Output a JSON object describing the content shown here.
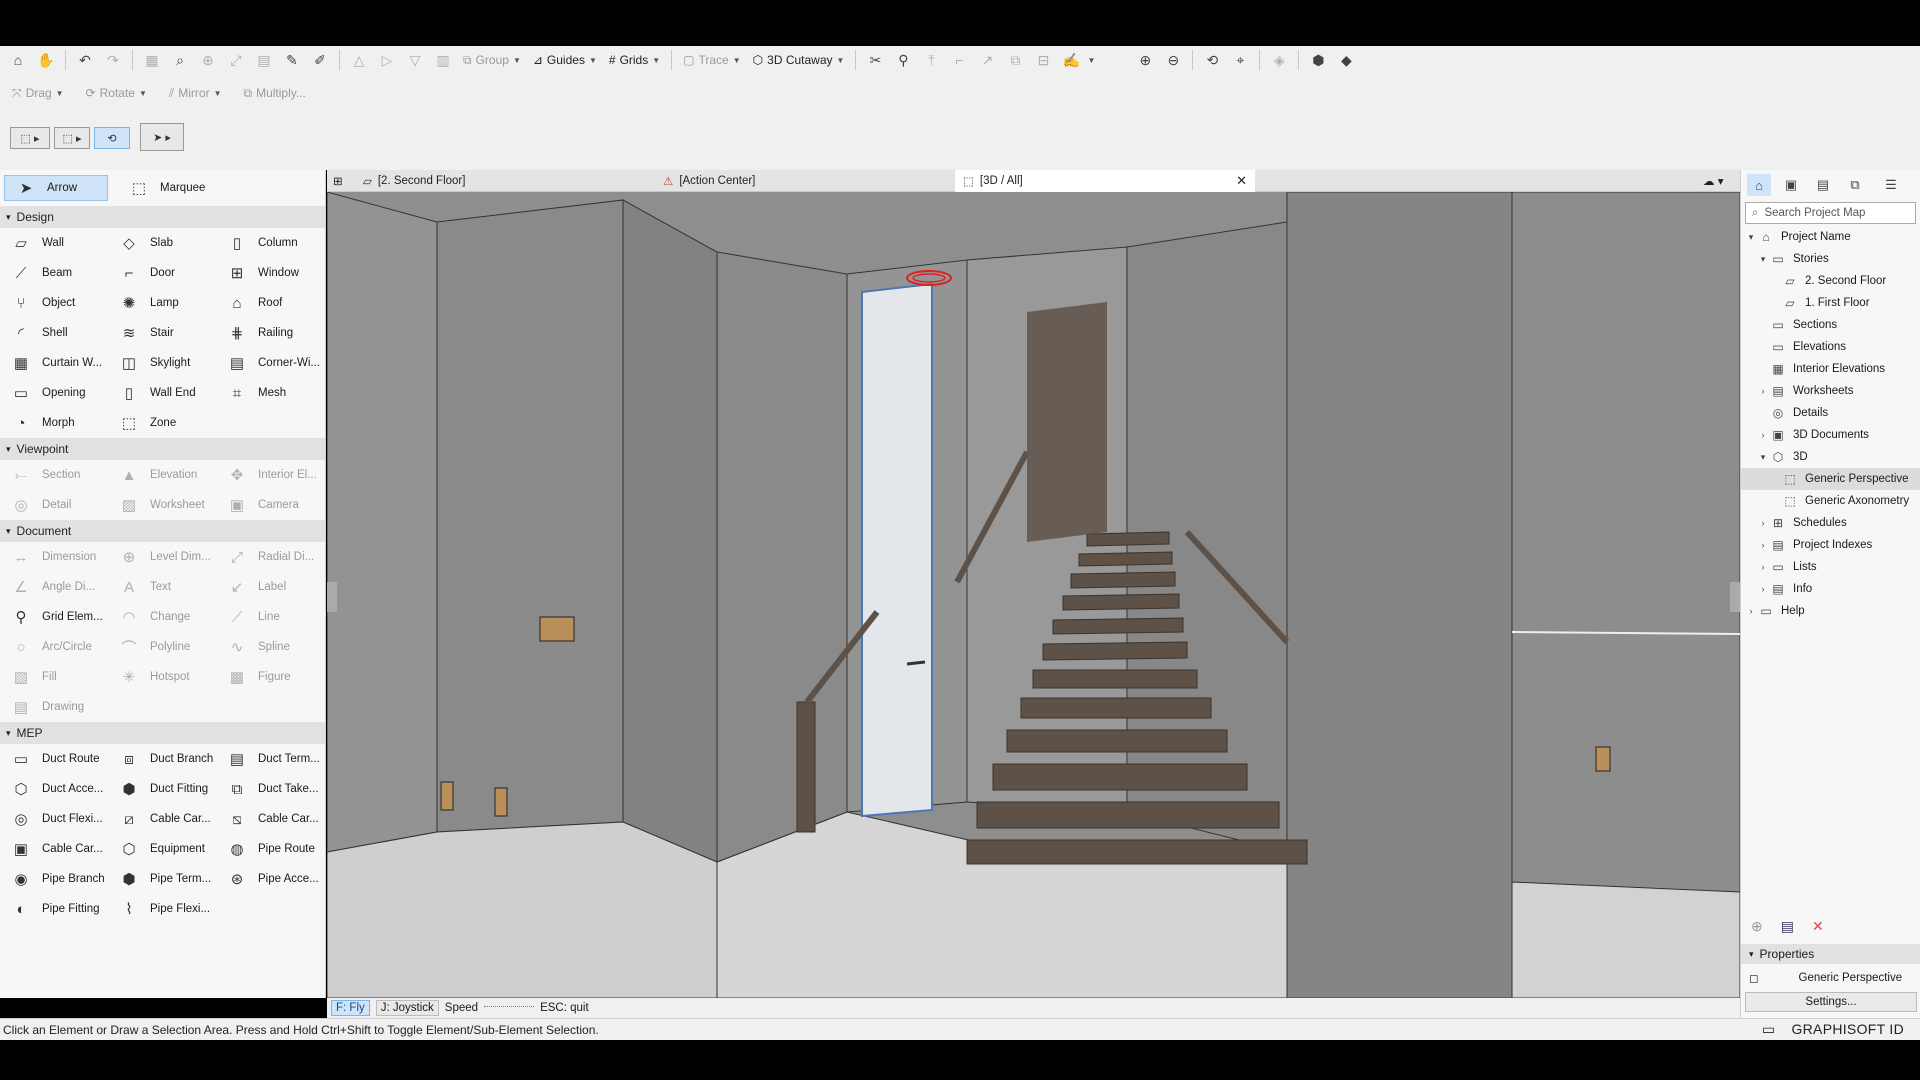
{
  "toolbar1": {
    "group_label": "Group",
    "guides_label": "Guides",
    "grids_label": "Grids",
    "trace_label": "Trace",
    "cutaway_label": "3D Cutaway"
  },
  "toolbar2": {
    "drag_label": "Drag",
    "rotate_label": "Rotate",
    "mirror_label": "Mirror",
    "multiply_label": "Multiply..."
  },
  "toolbox": {
    "arrow": "Arrow",
    "marquee": "Marquee",
    "sections": [
      {
        "title": "Design",
        "tools": [
          {
            "label": "Wall",
            "icon": "▱",
            "dim": false
          },
          {
            "label": "Slab",
            "icon": "◇",
            "dim": false
          },
          {
            "label": "Column",
            "icon": "▯",
            "dim": false
          },
          {
            "label": "Beam",
            "icon": "⟋",
            "dim": false
          },
          {
            "label": "Door",
            "icon": "⌐",
            "dim": false
          },
          {
            "label": "Window",
            "icon": "⊞",
            "dim": false
          },
          {
            "label": "Object",
            "icon": "⑂",
            "dim": false
          },
          {
            "label": "Lamp",
            "icon": "✺",
            "dim": false
          },
          {
            "label": "Roof",
            "icon": "⌂",
            "dim": false
          },
          {
            "label": "Shell",
            "icon": "◜",
            "dim": false
          },
          {
            "label": "Stair",
            "icon": "≋",
            "dim": false
          },
          {
            "label": "Railing",
            "icon": "⋕",
            "dim": false
          },
          {
            "label": "Curtain W...",
            "icon": "▦",
            "dim": false
          },
          {
            "label": "Skylight",
            "icon": "◫",
            "dim": false
          },
          {
            "label": "Corner-Wi...",
            "icon": "▤",
            "dim": false
          },
          {
            "label": "Opening",
            "icon": "▭",
            "dim": false
          },
          {
            "label": "Wall End",
            "icon": "▯",
            "dim": false
          },
          {
            "label": "Mesh",
            "icon": "⌗",
            "dim": false
          },
          {
            "label": "Morph",
            "icon": "◔",
            "dim": false
          },
          {
            "label": "Zone",
            "icon": "⬚",
            "dim": false
          }
        ]
      },
      {
        "title": "Viewpoint",
        "tools": [
          {
            "label": "Section",
            "icon": "⤚",
            "dim": true
          },
          {
            "label": "Elevation",
            "icon": "▲",
            "dim": true
          },
          {
            "label": "Interior El...",
            "icon": "✥",
            "dim": true
          },
          {
            "label": "Detail",
            "icon": "◎",
            "dim": true
          },
          {
            "label": "Worksheet",
            "icon": "▨",
            "dim": true
          },
          {
            "label": "Camera",
            "icon": "▣",
            "dim": true
          }
        ]
      },
      {
        "title": "Document",
        "tools": [
          {
            "label": "Dimension",
            "icon": "↔",
            "dim": true
          },
          {
            "label": "Level Dim...",
            "icon": "⊕",
            "dim": true
          },
          {
            "label": "Radial Di...",
            "icon": "⤢",
            "dim": true
          },
          {
            "label": "Angle Di...",
            "icon": "∠",
            "dim": true
          },
          {
            "label": "Text",
            "icon": "A",
            "dim": true
          },
          {
            "label": "Label",
            "icon": "↙",
            "dim": true
          },
          {
            "label": "Grid Elem...",
            "icon": "⚲",
            "dim": false
          },
          {
            "label": "Change",
            "icon": "◠",
            "dim": true
          },
          {
            "label": "Line",
            "icon": "⟋",
            "dim": true
          },
          {
            "label": "Arc/Circle",
            "icon": "○",
            "dim": true
          },
          {
            "label": "Polyline",
            "icon": "⌒",
            "dim": true
          },
          {
            "label": "Spline",
            "icon": "∿",
            "dim": true
          },
          {
            "label": "Fill",
            "icon": "▧",
            "dim": true
          },
          {
            "label": "Hotspot",
            "icon": "✳",
            "dim": true
          },
          {
            "label": "Figure",
            "icon": "▩",
            "dim": true
          },
          {
            "label": "Drawing",
            "icon": "▤",
            "dim": true
          }
        ]
      },
      {
        "title": "MEP",
        "tools": [
          {
            "label": "Duct Route",
            "icon": "▭",
            "dim": false
          },
          {
            "label": "Duct Branch",
            "icon": "⧈",
            "dim": false
          },
          {
            "label": "Duct Term...",
            "icon": "▤",
            "dim": false
          },
          {
            "label": "Duct Acce...",
            "icon": "⬡",
            "dim": false
          },
          {
            "label": "Duct Fitting",
            "icon": "⬢",
            "dim": false
          },
          {
            "label": "Duct Take...",
            "icon": "⧉",
            "dim": false
          },
          {
            "label": "Duct Flexi...",
            "icon": "◎",
            "dim": false
          },
          {
            "label": "Cable Car...",
            "icon": "⧄",
            "dim": false
          },
          {
            "label": "Cable Car...",
            "icon": "⧅",
            "dim": false
          },
          {
            "label": "Cable Car...",
            "icon": "▣",
            "dim": false
          },
          {
            "label": "Equipment",
            "icon": "⬡",
            "dim": false
          },
          {
            "label": "Pipe Route",
            "icon": "◍",
            "dim": false
          },
          {
            "label": "Pipe Branch",
            "icon": "◉",
            "dim": false
          },
          {
            "label": "Pipe Term...",
            "icon": "⬢",
            "dim": false
          },
          {
            "label": "Pipe Acce...",
            "icon": "⊛",
            "dim": false
          },
          {
            "label": "Pipe Fitting",
            "icon": "◐",
            "dim": false
          },
          {
            "label": "Pipe Flexi...",
            "icon": "⌇",
            "dim": false
          }
        ]
      }
    ]
  },
  "tabs": [
    {
      "label": "[2. Second Floor]",
      "icon": "▱"
    },
    {
      "label": "[Action Center]",
      "icon": "⚠"
    },
    {
      "label": "[3D / All]",
      "icon": "⬚"
    }
  ],
  "fly_bar": {
    "fly": "F: Fly",
    "joystick": "J: Joystick",
    "speed": "Speed",
    "esc": "ESC: quit"
  },
  "status_text": "Click an Element or Draw a Selection Area. Press and Hold Ctrl+Shift to Toggle Element/Sub-Element Selection.",
  "navigator": {
    "search_placeholder": "Search Project Map",
    "tree": [
      {
        "label": "Project Name",
        "level": 0,
        "twisty": "▾",
        "icon": "⌂"
      },
      {
        "label": "Stories",
        "level": 1,
        "twisty": "▾",
        "icon": "▭"
      },
      {
        "label": "2. Second Floor",
        "level": 2,
        "twisty": "",
        "icon": "▱"
      },
      {
        "label": "1. First Floor",
        "level": 2,
        "twisty": "",
        "icon": "▱"
      },
      {
        "label": "Sections",
        "level": 1,
        "twisty": "",
        "icon": "▭"
      },
      {
        "label": "Elevations",
        "level": 1,
        "twisty": "",
        "icon": "▭"
      },
      {
        "label": "Interior Elevations",
        "level": 1,
        "twisty": "",
        "icon": "▦"
      },
      {
        "label": "Worksheets",
        "level": 1,
        "twisty": "›",
        "icon": "▤"
      },
      {
        "label": "Details",
        "level": 1,
        "twisty": "",
        "icon": "◎"
      },
      {
        "label": "3D Documents",
        "level": 1,
        "twisty": "›",
        "icon": "▣"
      },
      {
        "label": "3D",
        "level": 1,
        "twisty": "▾",
        "icon": "⬡"
      },
      {
        "label": "Generic Perspective",
        "level": 2,
        "twisty": "",
        "icon": "⬚",
        "selected": true
      },
      {
        "label": "Generic Axonometry",
        "level": 2,
        "twisty": "",
        "icon": "⬚"
      },
      {
        "label": "Schedules",
        "level": 1,
        "twisty": "›",
        "icon": "⊞"
      },
      {
        "label": "Project Indexes",
        "level": 1,
        "twisty": "›",
        "icon": "▤"
      },
      {
        "label": "Lists",
        "level": 1,
        "twisty": "›",
        "icon": "▭"
      },
      {
        "label": "Info",
        "level": 1,
        "twisty": "›",
        "icon": "▤"
      },
      {
        "label": "Help",
        "level": 0,
        "twisty": "›",
        "icon": "▭"
      }
    ],
    "properties_title": "Properties",
    "properties_value": "Generic Perspective",
    "settings_label": "Settings..."
  },
  "brand": "GRAPHISOFT ID",
  "colors": {
    "selection": "#cfe4f8",
    "viewport_bg": "#8c8c8c",
    "stair_wood": "#5e5248"
  }
}
